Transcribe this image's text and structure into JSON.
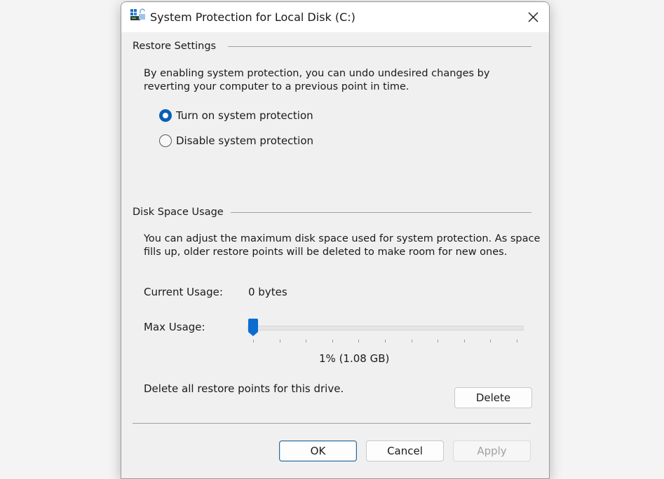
{
  "window": {
    "title": "System Protection for Local Disk (C:)",
    "icon": "system-protection-icon",
    "close_icon": "close-icon"
  },
  "restore_settings": {
    "header": "Restore Settings",
    "description_line1": "By enabling system protection, you can undo undesired changes by",
    "description_line2": "reverting your computer to a previous point in time.",
    "options": [
      {
        "label": "Turn on system protection",
        "selected": true
      },
      {
        "label": "Disable system protection",
        "selected": false
      }
    ]
  },
  "disk_space_usage": {
    "header": "Disk Space Usage",
    "description_line1": "You can adjust the maximum disk space used for system protection. As space",
    "description_line2": "fills up, older restore points will be deleted to make room for new ones.",
    "current_usage_label": "Current Usage:",
    "current_usage_value": "0 bytes",
    "max_usage_label": "Max Usage:",
    "max_usage_percent": 1,
    "max_usage_display": "1% (1.08 GB)",
    "slider_tick_count": 11,
    "delete_description": "Delete all restore points for this drive.",
    "delete_label": "Delete"
  },
  "footer": {
    "ok_label": "OK",
    "cancel_label": "Cancel",
    "apply_label": "Apply",
    "apply_disabled": true
  },
  "colors": {
    "accent": "#0a5fb4",
    "dialog_bg": "#f0f0f0",
    "titlebar_bg": "#ffffff"
  }
}
